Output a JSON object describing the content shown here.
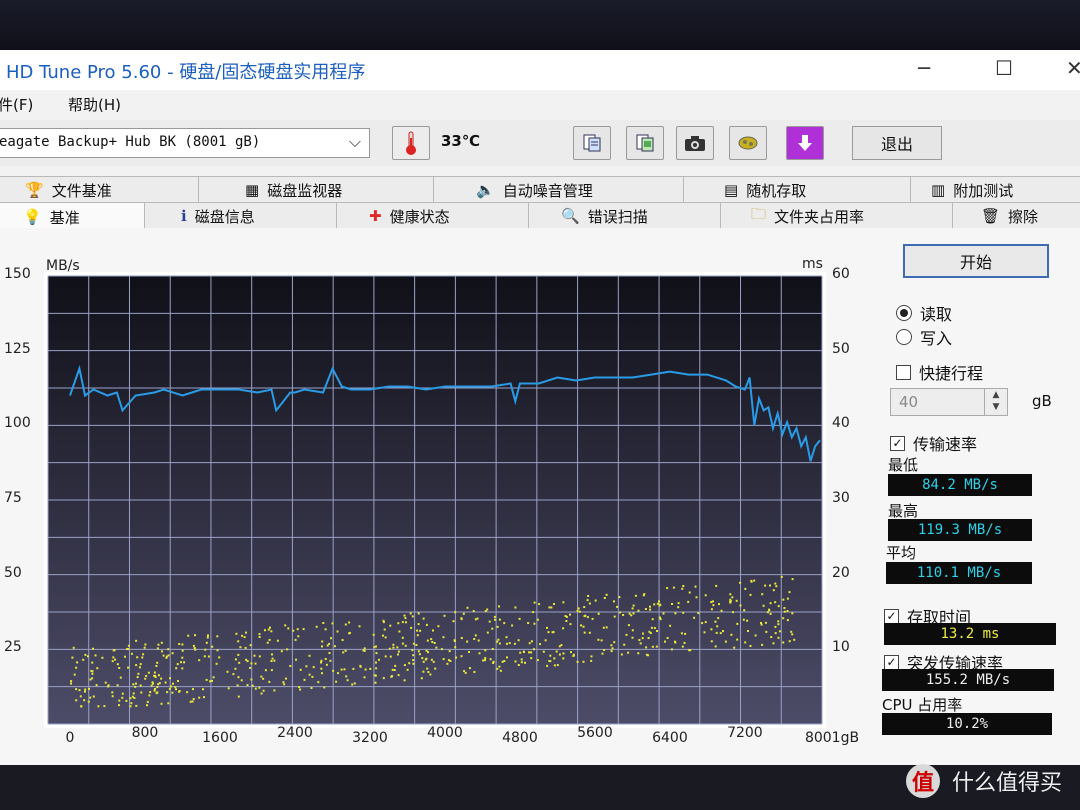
{
  "window": {
    "title": "HD Tune Pro 5.60 - 硬盘/固态硬盘实用程序",
    "minimize_glyph": "─",
    "maximize_glyph": "☐",
    "close_glyph": "✕"
  },
  "menu": {
    "file": "件(F)",
    "help": "帮助(H)"
  },
  "toolbar": {
    "drive": "eagate Backup+ Hub BK (8001 gB)",
    "temperature": "33℃",
    "exit": "退出",
    "icons": [
      "thermometer-icon",
      "copy-text-icon",
      "copy-screen-icon",
      "camera-icon",
      "health-icon",
      "download-icon"
    ]
  },
  "tabs_row1": [
    {
      "label": "文件基准",
      "icon": "file-benchmark-icon"
    },
    {
      "label": "磁盘监视器",
      "icon": "disk-monitor-icon"
    },
    {
      "label": "自动噪音管理",
      "icon": "speaker-icon"
    },
    {
      "label": "随机存取",
      "icon": "random-access-icon"
    },
    {
      "label": "附加测试",
      "icon": "extra-tests-icon"
    }
  ],
  "tabs_row2": [
    {
      "label": "基准",
      "icon": "lightbulb-icon"
    },
    {
      "label": "磁盘信息",
      "icon": "info-icon"
    },
    {
      "label": "健康状态",
      "icon": "health-cross-icon"
    },
    {
      "label": "错误扫描",
      "icon": "magnifier-icon"
    },
    {
      "label": "文件夹占用率",
      "icon": "folder-icon"
    },
    {
      "label": "擦除",
      "icon": "trash-icon"
    }
  ],
  "controls": {
    "start": "开始",
    "read": "读取",
    "write": "写入",
    "mode": "read",
    "short_stroke": "快捷行程",
    "short_stroke_checked": false,
    "short_stroke_value": "40",
    "short_stroke_unit": "gB",
    "transfer_rate": "传输速率",
    "transfer_rate_checked": true,
    "min_label": "最低",
    "min_value": "84.2 MB/s",
    "max_label": "最高",
    "max_value": "119.3 MB/s",
    "avg_label": "平均",
    "avg_value": "110.1 MB/s",
    "access_time": "存取时间",
    "access_time_checked": true,
    "access_time_value": "13.2 ms",
    "burst_rate": "突发传输速率",
    "burst_rate_checked": true,
    "burst_rate_value": "155.2 MB/s",
    "cpu_label": "CPU 占用率",
    "cpu_value": "10.2%"
  },
  "chart_data": {
    "type": "line",
    "y_left_unit": "MB/s",
    "y_right_unit": "ms",
    "x_unit": "gB",
    "ylim_left": [
      0,
      150
    ],
    "ylim_right": [
      0,
      60
    ],
    "xlim": [
      0,
      8001
    ],
    "y_left_ticks": [
      "150",
      "125",
      "100",
      "75",
      "50",
      "25"
    ],
    "y_right_ticks": [
      "60",
      "50",
      "40",
      "30",
      "20",
      "10"
    ],
    "x_ticks": [
      "0",
      "800",
      "1600",
      "2400",
      "3200",
      "4000",
      "4800",
      "5600",
      "6400",
      "7200",
      "8001gB"
    ],
    "grid": true,
    "series": [
      {
        "color": "#2a9be6",
        "x": [
          0,
          100,
          160,
          250,
          400,
          500,
          560,
          700,
          900,
          1000,
          1200,
          1300,
          1400,
          1600,
          1800,
          2000,
          2150,
          2200,
          2350,
          2400,
          2500,
          2700,
          2800,
          2900,
          3000,
          3200,
          3400,
          3600,
          3800,
          4000,
          4200,
          4500,
          4700,
          4750,
          4800,
          5000,
          5200,
          5400,
          5600,
          5800,
          6000,
          6200,
          6400,
          6600,
          6800,
          7000,
          7100,
          7200,
          7250,
          7300,
          7350,
          7400,
          7450,
          7500,
          7550,
          7600,
          7650,
          7700,
          7750,
          7800,
          7850,
          7900,
          7950,
          8001
        ],
        "values": [
          110,
          119,
          110,
          112,
          110,
          111,
          105,
          110,
          111,
          112,
          110,
          111,
          112,
          112,
          112,
          111,
          112,
          105,
          111,
          111,
          112,
          111,
          119,
          113,
          112,
          112,
          113,
          113,
          112,
          113,
          113,
          113,
          114,
          108,
          114,
          114,
          116,
          115,
          116,
          116,
          116,
          117,
          118,
          117,
          117,
          115,
          113,
          112,
          116,
          100,
          109,
          105,
          106,
          99,
          104,
          97,
          101,
          96,
          99,
          93,
          96,
          88,
          93,
          95
        ],
        "name": ""
      }
    ],
    "access_time_points_note": "",
    "access_time_color": "#e8e83a"
  },
  "watermark": "什么值得买"
}
